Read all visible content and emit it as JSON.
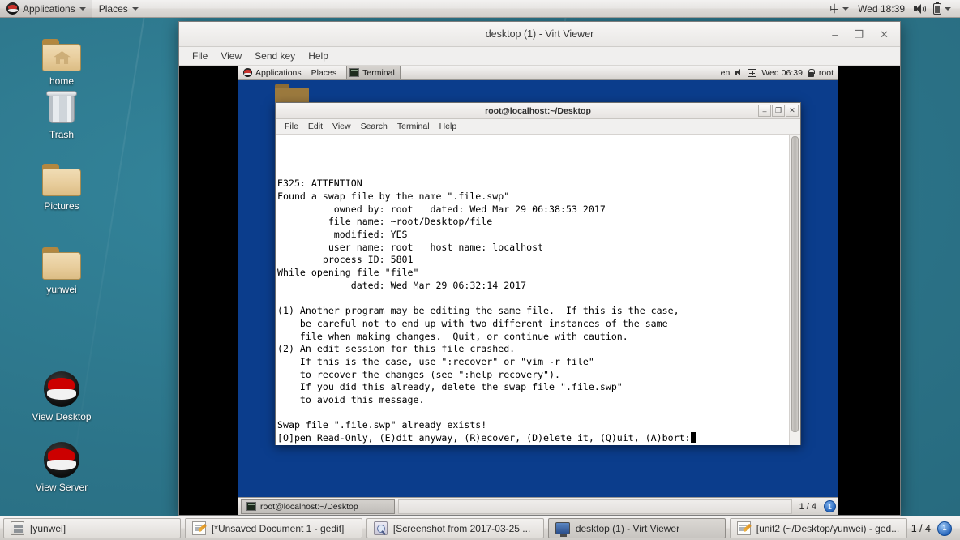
{
  "host": {
    "top_panel": {
      "logo_icon": "redhat-logo-icon",
      "applications": "Applications",
      "places": "Places",
      "input_method": "中",
      "clock": "Wed 18:39",
      "volume_icon": "speaker-icon",
      "battery_icon": "battery-icon",
      "dropdown_icon": "chevron-down-icon"
    },
    "desktop_icons": [
      {
        "label": "home",
        "icon": "home-folder-icon"
      },
      {
        "label": "Trash",
        "icon": "trash-icon"
      },
      {
        "label": "Pictures",
        "icon": "folder-icon"
      },
      {
        "label": "yunwei",
        "icon": "folder-icon"
      },
      {
        "label": "View Desktop",
        "icon": "redhat-logo-icon"
      },
      {
        "label": "View Server",
        "icon": "redhat-logo-icon"
      }
    ],
    "taskbar": {
      "items": [
        {
          "label": "[yunwei]",
          "icon": "files-icon",
          "active": false
        },
        {
          "label": "[*Unsaved Document 1 - gedit]",
          "icon": "gedit-icon",
          "active": false
        },
        {
          "label": "[Screenshot from 2017-03-25 ...",
          "icon": "screenshot-icon",
          "active": false
        },
        {
          "label": "desktop (1) - Virt Viewer",
          "icon": "monitor-icon",
          "active": true
        },
        {
          "label": "[unit2 (~/Desktop/yunwei) - ged...",
          "icon": "gedit-icon",
          "active": false
        }
      ],
      "workspace_count": "1 / 4",
      "workspace_current": "1"
    }
  },
  "virt_viewer": {
    "title": "desktop (1) - Virt Viewer",
    "menus": [
      "File",
      "View",
      "Send key",
      "Help"
    ],
    "window_controls": {
      "minimize": "–",
      "maximize": "❐",
      "close": "✕"
    }
  },
  "guest": {
    "top_panel": {
      "applications": "Applications",
      "places": "Places",
      "window_button": "Terminal",
      "input_method": "en",
      "volume_icon": "speaker-icon",
      "network_icon": "network-icon",
      "clock": "Wed 06:39",
      "user_icon": "lock-icon",
      "user": "root"
    },
    "terminal": {
      "title": "root@localhost:~/Desktop",
      "menus": [
        "File",
        "Edit",
        "View",
        "Search",
        "Terminal",
        "Help"
      ],
      "window_controls": {
        "minimize": "–",
        "maximize": "❐",
        "close": "✕"
      },
      "output": "\n\n\nE325: ATTENTION\nFound a swap file by the name \".file.swp\"\n          owned by: root   dated: Wed Mar 29 06:38:53 2017\n         file name: ~root/Desktop/file\n          modified: YES\n         user name: root   host name: localhost\n        process ID: 5801\nWhile opening file \"file\"\n             dated: Wed Mar 29 06:32:14 2017\n\n(1) Another program may be editing the same file.  If this is the case,\n    be careful not to end up with two different instances of the same\n    file when making changes.  Quit, or continue with caution.\n(2) An edit session for this file crashed.\n    If this is the case, use \":recover\" or \"vim -r file\"\n    to recover the changes (see \":help recovery\").\n    If you did this already, delete the swap file \".file.swp\"\n    to avoid this message.\n\nSwap file \".file.swp\" already exists!\n[O]pen Read-Only, (E)dit anyway, (R)ecover, (D)elete it, (Q)uit, (A)bort:"
    },
    "taskbar": {
      "items": [
        {
          "label": "root@localhost:~/Desktop",
          "icon": "terminal-icon"
        }
      ],
      "workspace_count": "1 / 4",
      "workspace_current": "1"
    }
  },
  "colors": {
    "host_desktop": "#2d7a8c",
    "guest_desktop": "#0b3d8c",
    "panel": "#e7e5e3",
    "accent_blue": "#2060b8",
    "redhat_red": "#cc0000"
  }
}
